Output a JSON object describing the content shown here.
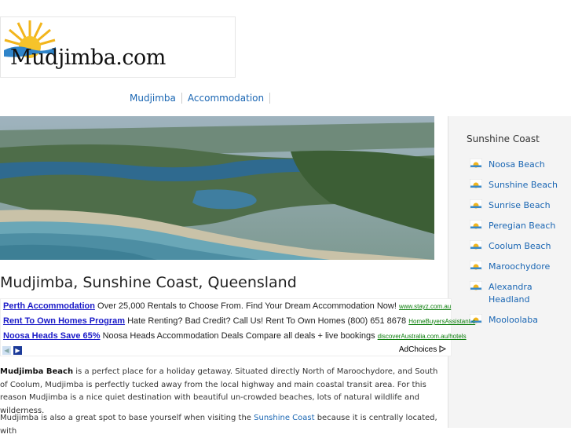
{
  "header": {
    "logo_text": "Mudjimba.com"
  },
  "nav": {
    "items": [
      "Mudjimba",
      "Accommodation"
    ]
  },
  "sidebar": {
    "title": "Sunshine Coast",
    "items": [
      "Noosa Beach",
      "Sunshine Beach",
      "Sunrise Beach",
      "Peregian Beach",
      "Coolum Beach",
      "Maroochydore",
      "Alexandra Headland",
      "Mooloolaba"
    ]
  },
  "main": {
    "title": "Mudjimba, Sunshine Coast, Queensland",
    "p1_bold": "Mudjimba Beach",
    "p1_rest": " is a perfect place for a holiday getaway. Situated directly North of Maroochydore, and South of Coolum, Mudjimba is perfectly tucked away from the local highway and main coastal transit area. For this reason Mudjimba is a nice quiet destination with beautiful un-crowded beaches, lots of natural wildlife and wilderness.",
    "p2_start": "Mudjimba is also a great spot to base yourself when visiting the ",
    "p2_link": "Sunshine Coast",
    "p2_end": " because it is centrally located, with"
  },
  "ads": {
    "items": [
      {
        "title": "Perth Accommodation",
        "text": "Over 25,000 Rentals to Choose From. Find Your Dream Accommodation Now!",
        "url": "www.stayz.com.au"
      },
      {
        "title": "Rent To Own Homes Program",
        "text": "Hate Renting? Bad Credit? Call Us! Rent To Own Homes (800) 651 8678",
        "url": "HomeBuyersAssistant.c"
      },
      {
        "title": "Noosa Heads Save 65%",
        "text": "Noosa Heads Accommodation Deals Compare all deals + live bookings",
        "url": "discoverAustralia.com.au/hotels"
      }
    ],
    "adchoices": "AdChoices",
    "prev_arrow": "◀",
    "next_arrow": "▶"
  },
  "colors": {
    "link": "#1a66b3",
    "ad_title": "#1a1ac8",
    "ad_url": "#0a7d0a",
    "sidebar_bg": "#f4f4f4"
  }
}
